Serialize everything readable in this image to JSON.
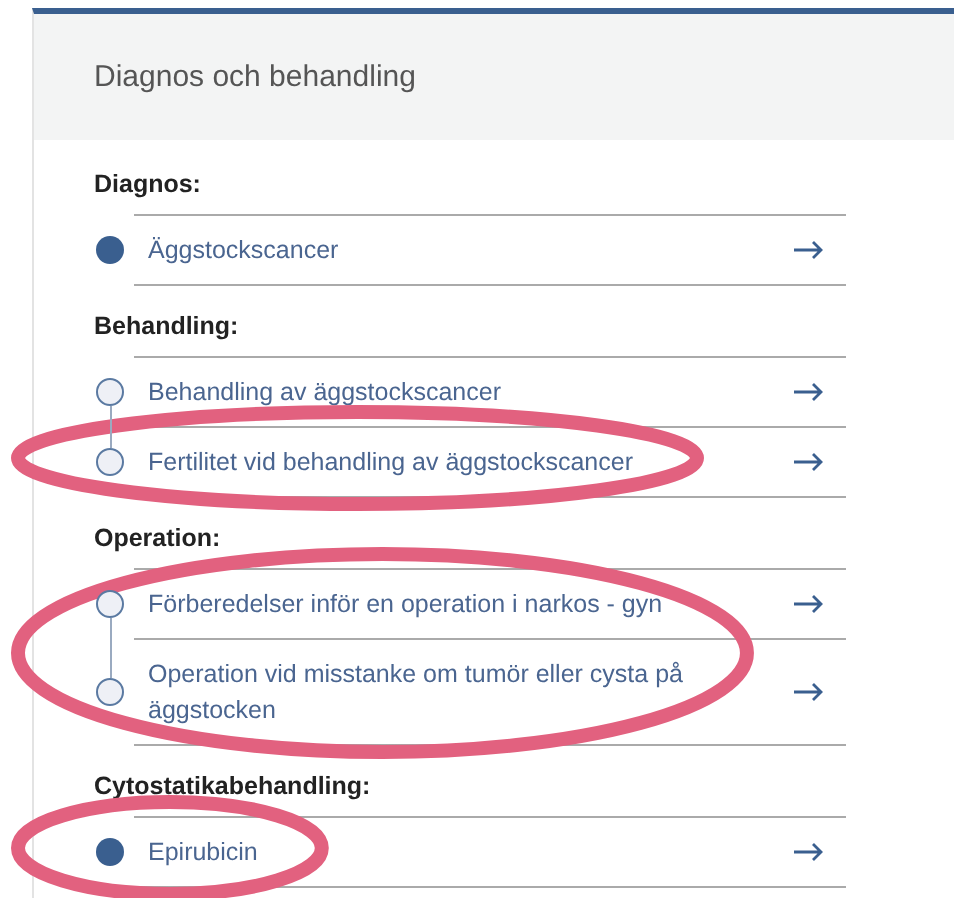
{
  "card": {
    "title": "Diagnos och behandling"
  },
  "sections": [
    {
      "heading": "Diagnos:",
      "items": [
        {
          "label": "Äggstockscancer",
          "filled": true,
          "circled": false
        }
      ]
    },
    {
      "heading": "Behandling:",
      "items": [
        {
          "label": "Behandling av äggstockscancer",
          "filled": false,
          "circled": false
        },
        {
          "label": "Fertilitet vid behandling av äggstockscancer",
          "filled": false,
          "circled": true
        }
      ]
    },
    {
      "heading": "Operation:",
      "items": [
        {
          "label": "Förberedelser inför en operation i narkos - gyn",
          "filled": false,
          "circled": true
        },
        {
          "label": "Operation vid misstanke om tumör eller cysta på äggstocken",
          "filled": false,
          "circled": true
        }
      ]
    },
    {
      "heading": "Cytostatikabehandling:",
      "items": [
        {
          "label": "Epirubicin",
          "filled": true,
          "circled": true
        }
      ]
    }
  ]
}
